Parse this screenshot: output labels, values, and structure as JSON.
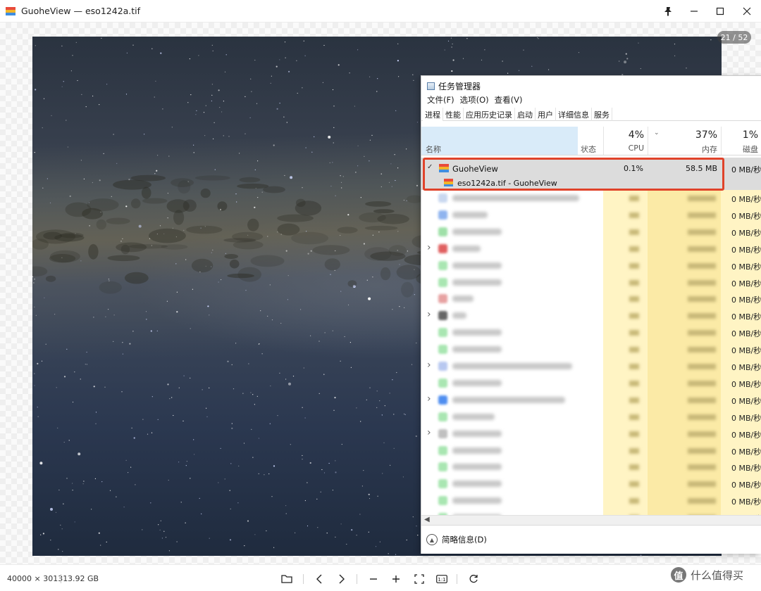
{
  "app": {
    "title": "GuoheView — eso1242a.tif",
    "page_counter": "21 / 52"
  },
  "statusbar": {
    "dimensions": "40000 × 30131",
    "file_size": "3.92 GB",
    "watermark": "什么值得买"
  },
  "task_manager": {
    "title": "任务管理器",
    "menu": [
      "文件(F)",
      "选项(O)",
      "查看(V)"
    ],
    "tabs": [
      "进程",
      "性能",
      "应用历史记录",
      "启动",
      "用户",
      "详细信息",
      "服务"
    ],
    "headers": {
      "name": "名称",
      "status": "状态",
      "cpu_pct": "4%",
      "cpu_label": "CPU",
      "mem_pct": "37%",
      "mem_label": "内存",
      "disk_pct": "1%",
      "disk_label": "磁盘"
    },
    "highlighted": {
      "name": "GuoheView",
      "child": "eso1242a.tif - GuoheView",
      "cpu": "0.1%",
      "memory": "58.5 MB",
      "disk": "0 MB/秒"
    },
    "rows_disk": [
      "0 MB/秒",
      "0 MB/秒",
      "0 MB/秒",
      "0 MB/秒",
      "0 MB/秒",
      "0 MB/秒",
      "0 MB/秒",
      "0 MB/秒",
      "0 MB/秒",
      "0 MB/秒",
      "0 MB/秒",
      "0 MB/秒",
      "0 MB/秒",
      "0 MB/秒",
      "0 MB/秒",
      "0 MB/秒",
      "0 MB/秒",
      "0 MB/秒",
      "0 MB/秒",
      "0 MB/秒"
    ],
    "footer": "简略信息(D)"
  },
  "colors": {
    "highlight_border": "#e0432a",
    "cpu_column": "#fff4c4",
    "mem_column": "#fbeaa6",
    "name_header": "#d9ebf9"
  }
}
